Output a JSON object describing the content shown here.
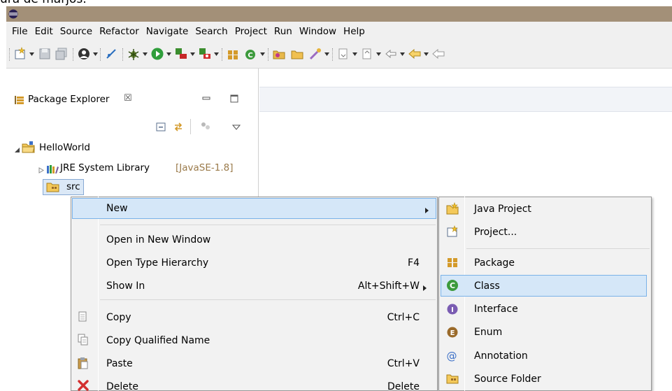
{
  "page_fragment": "ura de marjos:",
  "window": {
    "title_bar_color": "#a39078"
  },
  "menubar": {
    "items": [
      "File",
      "Edit",
      "Source",
      "Refactor",
      "Navigate",
      "Search",
      "Project",
      "Run",
      "Window",
      "Help"
    ]
  },
  "toolbar": {
    "icons": [
      "new-wizard-icon",
      "save-icon",
      "save-all-icon",
      "profile-icon",
      "skip-breakpoints-icon",
      "debug-icon",
      "run-icon",
      "run-last-icon",
      "coverage-icon",
      "new-package-icon",
      "new-class-icon",
      "open-type-icon",
      "open-task-icon",
      "search-icon",
      "next-annotation-icon",
      "prev-annotation-icon",
      "back-icon",
      "forward-icon"
    ]
  },
  "package_explorer": {
    "title": "Package Explorer",
    "close_glyph": "☒",
    "tree": {
      "project": "HelloWorld",
      "library": "JRE System Library",
      "library_version": "[JavaSE-1.8]",
      "source_folder": "src"
    }
  },
  "context_menu": {
    "items": [
      {
        "label": "New",
        "shortcut": "",
        "submenu": true
      },
      {
        "label": "Open in New Window",
        "shortcut": ""
      },
      {
        "label": "Open Type Hierarchy",
        "shortcut": "F4"
      },
      {
        "label": "Show In",
        "shortcut": "Alt+Shift+W",
        "submenu": true
      },
      {
        "label": "Copy",
        "shortcut": "Ctrl+C"
      },
      {
        "label": "Copy Qualified Name",
        "shortcut": ""
      },
      {
        "label": "Paste",
        "shortcut": "Ctrl+V"
      },
      {
        "label": "Delete",
        "shortcut": "Delete"
      }
    ]
  },
  "new_submenu": {
    "items": [
      {
        "label": "Java Project",
        "icon": "java-project-icon"
      },
      {
        "label": "Project...",
        "icon": "project-icon"
      },
      {
        "label": "Package",
        "icon": "package-icon"
      },
      {
        "label": "Class",
        "icon": "class-icon",
        "selected": true
      },
      {
        "label": "Interface",
        "icon": "interface-icon"
      },
      {
        "label": "Enum",
        "icon": "enum-icon"
      },
      {
        "label": "Annotation",
        "icon": "annotation-icon"
      },
      {
        "label": "Source Folder",
        "icon": "source-folder-icon"
      }
    ]
  },
  "colors": {
    "highlight_fill": "#d5e7f8",
    "highlight_border": "#7ab2e8",
    "menu_bg": "#f2f2f2",
    "chrome_bg": "#f0f0f0"
  }
}
